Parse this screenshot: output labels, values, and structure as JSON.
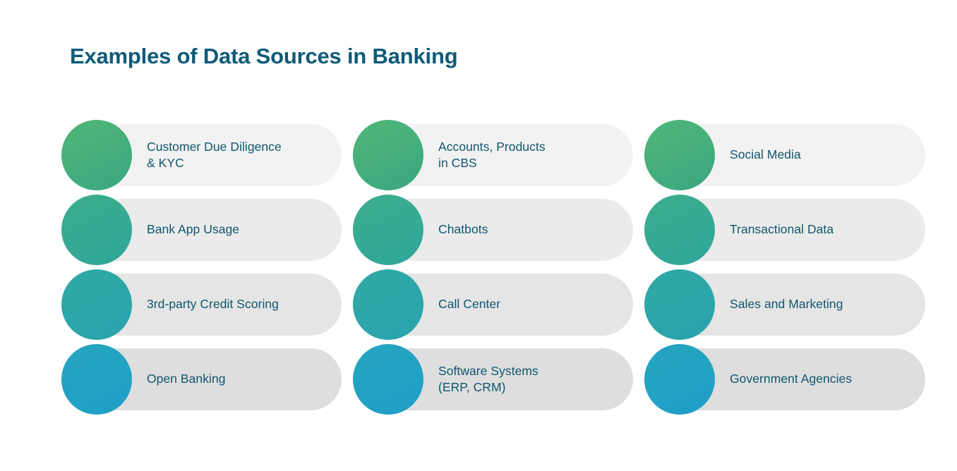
{
  "page": {
    "title": "Examples of Data Sources in Banking",
    "background_color": "#FFFFFF",
    "title_color": "#0E5A78",
    "label_color": "#10566E"
  },
  "palette": {
    "row_circle_colors": [
      "#50B677",
      "#3CAE8C",
      "#2FA9A4",
      "#25A5BE"
    ],
    "row_pill_colors": [
      "#F1F2F1",
      "#EAEBEA",
      "#E4E5E4",
      "#DEDEDE"
    ]
  },
  "columns": [
    {
      "items": [
        {
          "label": "Customer Due Diligence\n& KYC"
        },
        {
          "label": "Bank App Usage"
        },
        {
          "label": "3rd-party Credit Scoring"
        },
        {
          "label": "Open Banking"
        }
      ]
    },
    {
      "items": [
        {
          "label": "Accounts, Products\nin CBS"
        },
        {
          "label": "Chatbots"
        },
        {
          "label": "Call Center"
        },
        {
          "label": "Software Systems\n(ERP, CRM)"
        }
      ]
    },
    {
      "items": [
        {
          "label": "Social Media"
        },
        {
          "label": "Transactional Data"
        },
        {
          "label": "Sales and Marketing"
        },
        {
          "label": "Government Agencies"
        }
      ]
    }
  ]
}
